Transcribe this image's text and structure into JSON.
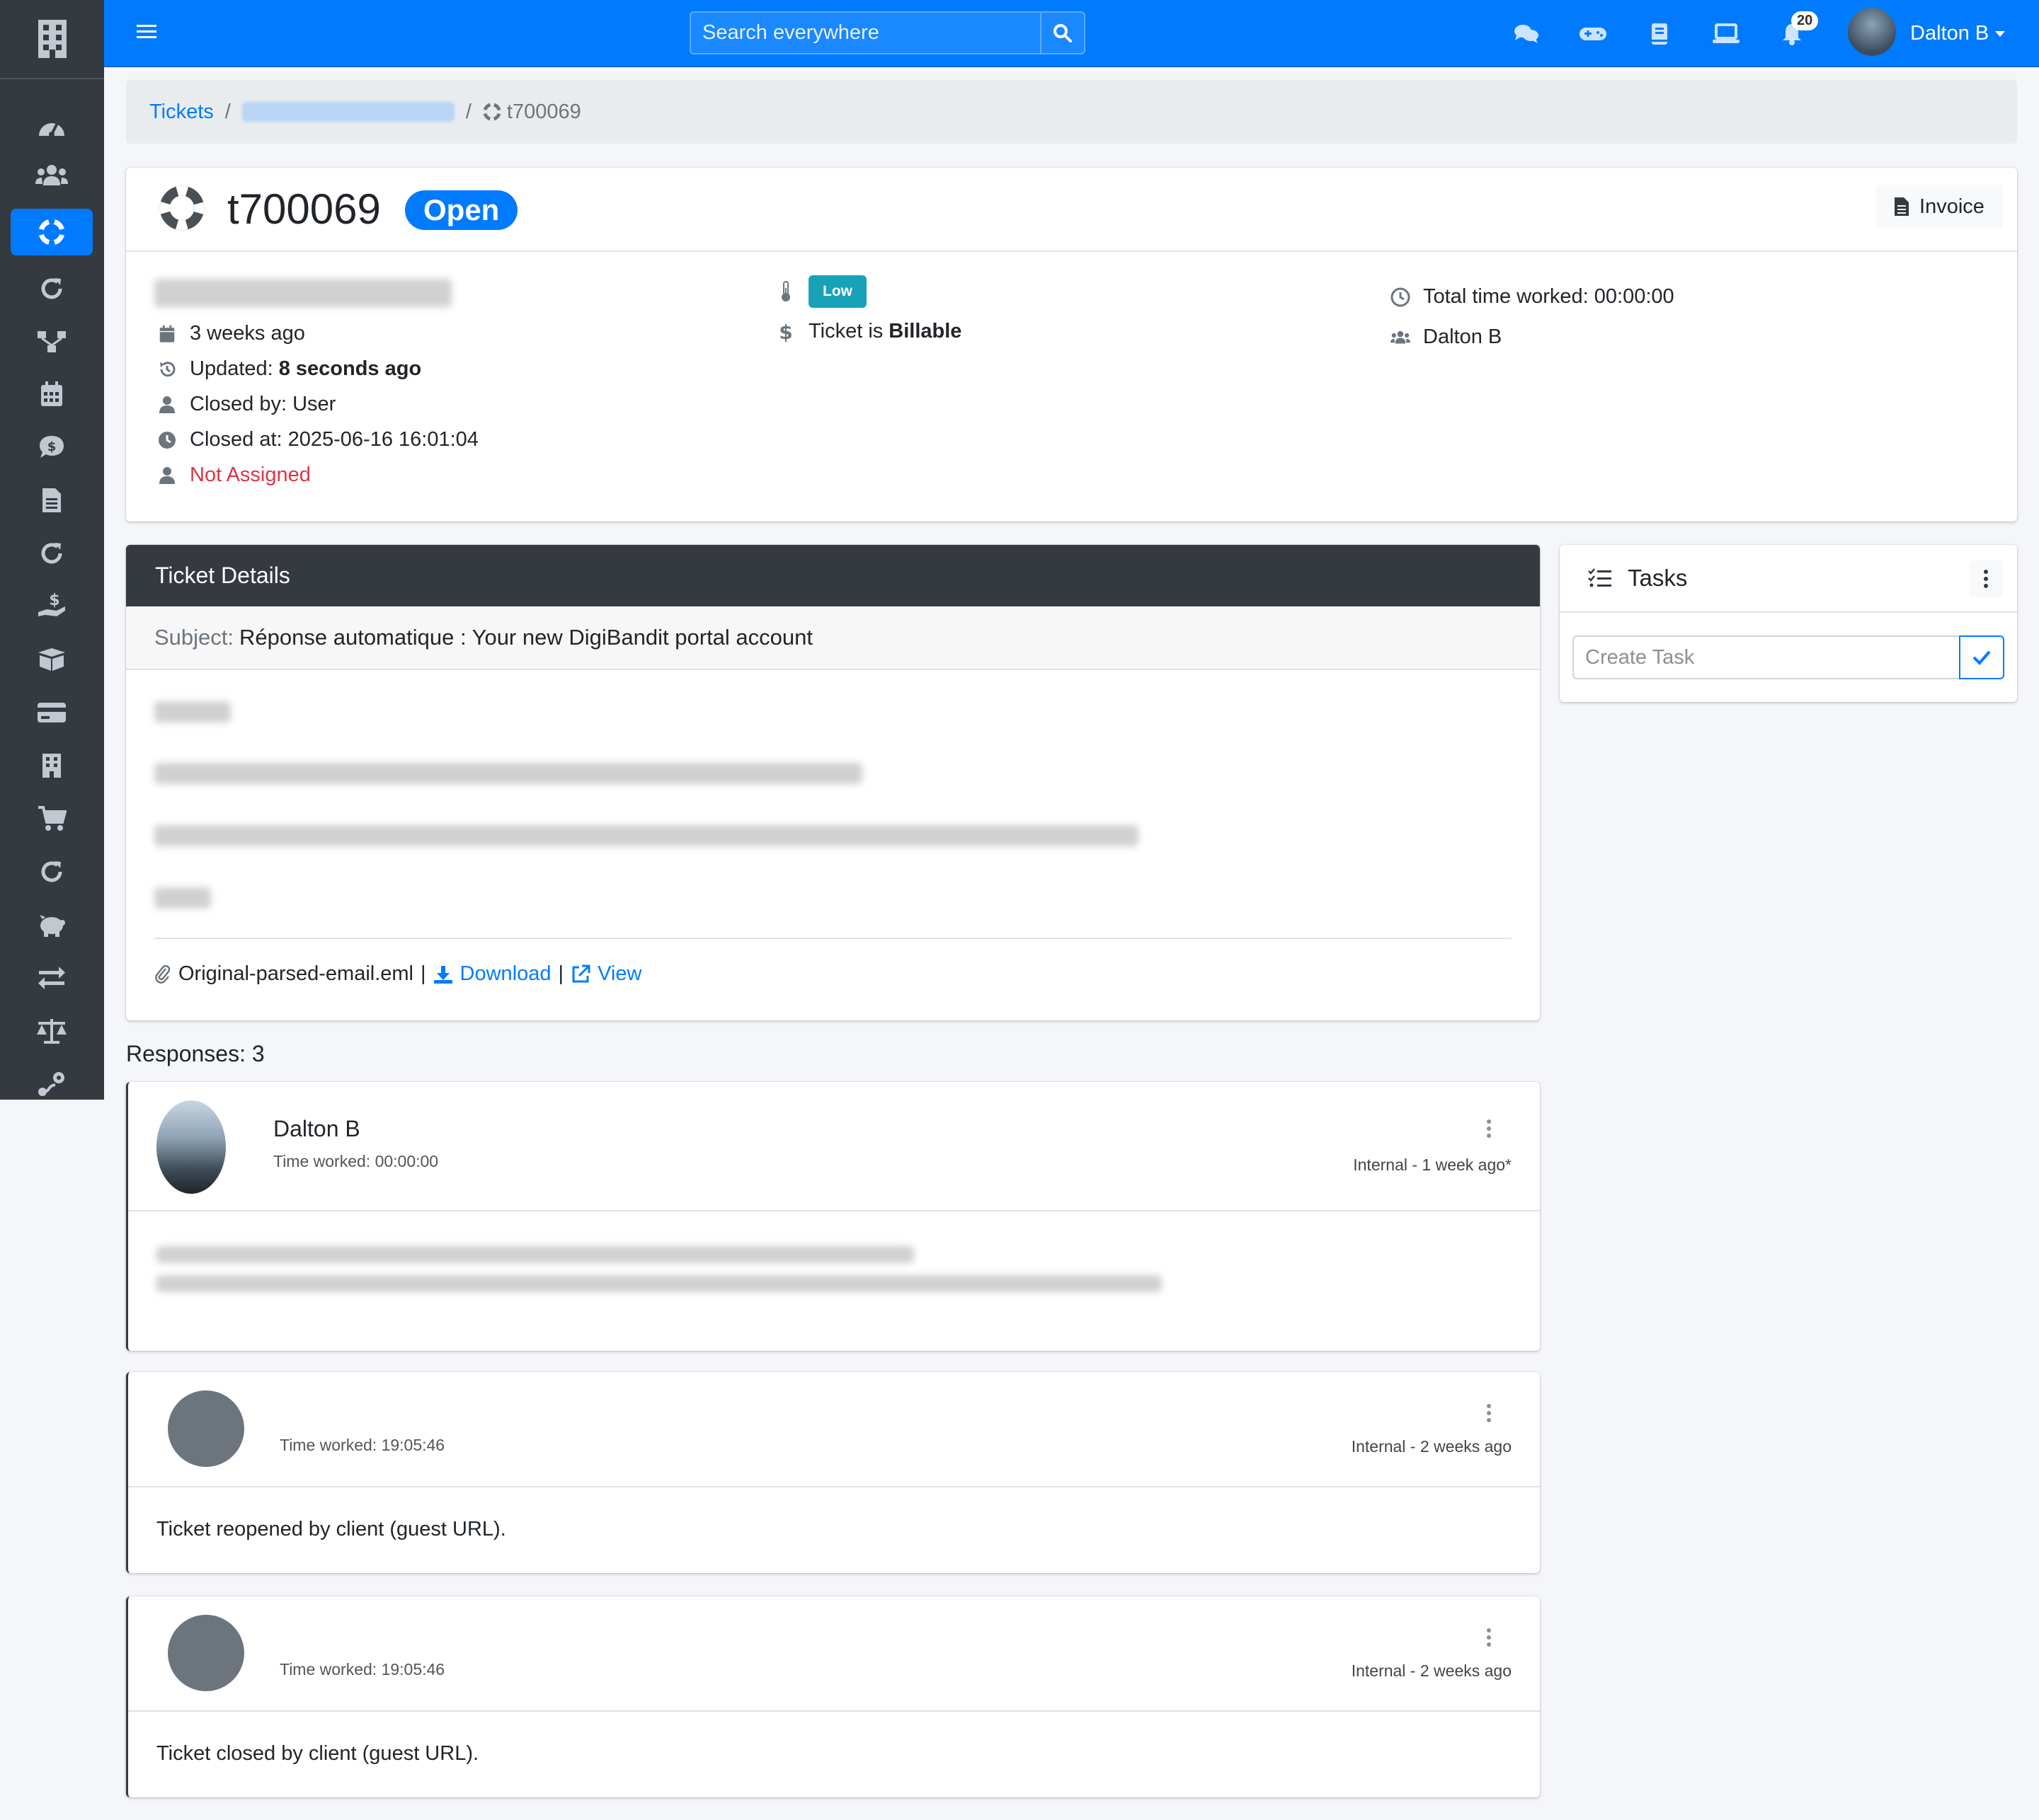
{
  "navbar": {
    "search_placeholder": "Search everywhere",
    "notification_count": "20",
    "user_name": "Dalton B"
  },
  "breadcrumb": {
    "tickets": "Tickets",
    "current": "t700069"
  },
  "ticket": {
    "id": "t700069",
    "status": "Open",
    "invoice_label": "Invoice",
    "created": "3 weeks ago",
    "updated_label": "Updated:",
    "updated_value": "8 seconds ago",
    "closed_by": "Closed by: User",
    "closed_at": "Closed at: 2025-06-16 16:01:04",
    "assignment": "Not Assigned",
    "priority": "Low",
    "billable_prefix": "Ticket is",
    "billable_value": "Billable",
    "total_time": "Total time worked: 00:00:00",
    "watcher": "Dalton B"
  },
  "details": {
    "title": "Ticket Details",
    "subject_label": "Subject:",
    "subject_value": "Réponse automatique : Your new DigiBandit portal account",
    "attachment_name": "Original-parsed-email.eml",
    "separator": "|",
    "download_label": "Download",
    "view_label": "View"
  },
  "tasks": {
    "title": "Tasks",
    "input_placeholder": "Create Task"
  },
  "responses": {
    "title": "Responses: 3",
    "items": [
      {
        "author": "Dalton B",
        "time_worked": "Time worked: 00:00:00",
        "meta": "Internal - 1 week ago*"
      },
      {
        "author": "",
        "time_worked": "Time worked: 19:05:46",
        "meta": "Internal - 2 weeks ago",
        "body": "Ticket reopened by client (guest URL)."
      },
      {
        "author": "",
        "time_worked": "Time worked: 19:05:46",
        "meta": "Internal - 2 weeks ago",
        "body": "Ticket closed by client (guest URL)."
      }
    ]
  },
  "colors": {
    "primary": "#007bff",
    "sidebar": "#343a40",
    "danger": "#dc3545",
    "info": "#17a2b8"
  },
  "icons": {
    "sidebar": [
      "dashboard-icon",
      "clients-icon",
      "support-icon",
      "recurring-icon",
      "projects-icon",
      "calendar-icon",
      "quotes-icon",
      "invoices-icon",
      "recurring-invoices-icon",
      "revenues-icon",
      "products-icon",
      "payments-icon",
      "vendors-icon",
      "cart-icon",
      "recurring-expenses-icon",
      "budget-icon",
      "transfers-icon",
      "accounting-icon",
      "trips-icon"
    ]
  }
}
